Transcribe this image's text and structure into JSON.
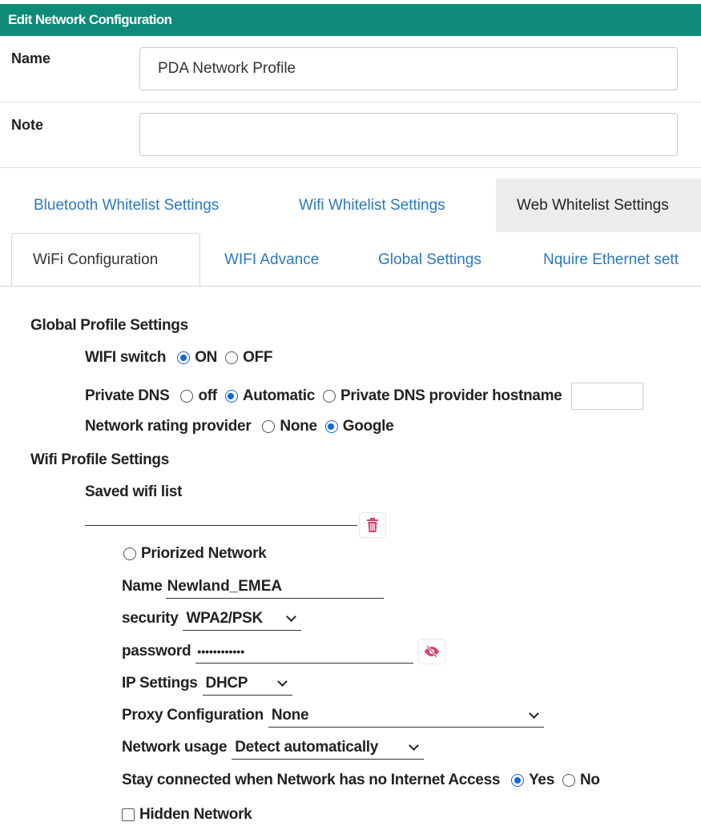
{
  "dialog": {
    "title": "Edit Network Configuration"
  },
  "form": {
    "name_label": "Name",
    "name_value": "PDA Network Profile",
    "note_label": "Note",
    "note_value": ""
  },
  "tabs_top": [
    {
      "label": "Bluetooth Whitelist Settings",
      "active": false
    },
    {
      "label": "Wifi Whitelist Settings",
      "active": false
    },
    {
      "label": "Web Whitelist Settings",
      "active": true
    }
  ],
  "tabs_sub": [
    {
      "label": "WiFi Configuration",
      "active": true
    },
    {
      "label": "WIFI Advance",
      "active": false
    },
    {
      "label": "Global Settings",
      "active": false
    },
    {
      "label": "Nquire Ethernet sett",
      "active": false
    }
  ],
  "global_profile": {
    "heading": "Global Profile Settings",
    "wifi_switch": {
      "label": "WIFI switch",
      "options": [
        "ON",
        "OFF"
      ],
      "selected": "ON"
    },
    "private_dns": {
      "label": "Private DNS",
      "options": [
        "off",
        "Automatic",
        "Private DNS provider hostname"
      ],
      "selected": "Automatic",
      "hostname_value": ""
    },
    "network_rating": {
      "label": "Network rating provider",
      "options": [
        "None",
        "Google"
      ],
      "selected": "Google"
    }
  },
  "wifi_profile": {
    "heading": "Wifi Profile Settings",
    "saved_list_label": "Saved wifi list",
    "entry": {
      "prioritized_label": "Priorized Network",
      "prioritized": false,
      "name_label": "Name",
      "name_value": "Newland_EMEA",
      "security_label": "security",
      "security_value": "WPA2/PSK",
      "password_label": "password",
      "password_value": "••••••••••••",
      "ip_label": "IP Settings",
      "ip_value": "DHCP",
      "proxy_label": "Proxy Configuration",
      "proxy_value": "None",
      "usage_label": "Network usage",
      "usage_value": "Detect automatically",
      "stay_connected_label": "Stay connected when Network has no Internet Access",
      "stay_connected_options": [
        "Yes",
        "No"
      ],
      "stay_connected_selected": "Yes",
      "hidden_label": "Hidden Network",
      "hidden": false
    }
  },
  "icons": {
    "delete": "trash-icon",
    "reveal": "eye-slash-icon"
  },
  "colors": {
    "header": "#0e8a79",
    "link": "#2a78c4",
    "radio_on": "#1566d6",
    "icon": "#d9416b"
  }
}
